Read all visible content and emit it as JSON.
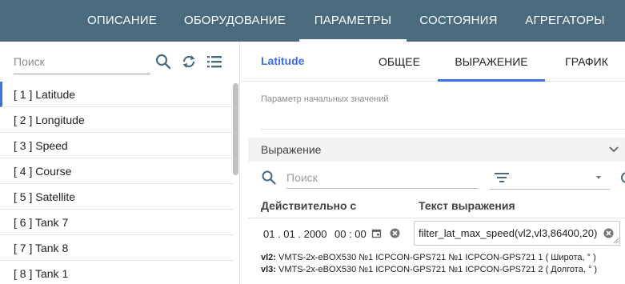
{
  "topnav": {
    "tabs": [
      {
        "label": "ОПИСАНИЕ"
      },
      {
        "label": "ОБОРУДОВАНИЕ"
      },
      {
        "label": "ПАРАМЕТРЫ"
      },
      {
        "label": "СОСТОЯНИЯ"
      },
      {
        "label": "АГРЕГАТОРЫ"
      }
    ],
    "active": "ПАРАМЕТРЫ"
  },
  "sidebar": {
    "search_placeholder": "Поиск",
    "icons": [
      "search-icon",
      "refresh-icon",
      "list-icon"
    ],
    "items": [
      {
        "label": "[ 1 ] Latitude",
        "selected": true
      },
      {
        "label": "[ 2 ] Longitude"
      },
      {
        "label": "[ 3 ] Speed"
      },
      {
        "label": "[ 4 ] Course"
      },
      {
        "label": "[ 5 ] Satellite"
      },
      {
        "label": "[ 6 ] Tank 7"
      },
      {
        "label": "[ 7 ] Tank 8"
      },
      {
        "label": "[ 8 ] Tank 1"
      }
    ]
  },
  "content": {
    "param_title": "Latitude",
    "tabs": [
      {
        "label": "ОБЩЕЕ"
      },
      {
        "label": "ВЫРАЖЕНИЕ"
      },
      {
        "label": "ГРАФИК"
      }
    ],
    "active_tab": "ВЫРАЖЕНИЕ",
    "initial_values_label": "Параметр начальных значений"
  },
  "expression": {
    "title": "Выражение",
    "search_placeholder": "Поиск",
    "columns": {
      "valid_from": "Действительно с",
      "expr_text": "Текст выражения"
    },
    "row": {
      "date": "01 . 01 . 2000",
      "time": "00 : 00",
      "expression": "filter_lat_max_speed(vl2,vl3,86400,20)"
    },
    "vars": [
      {
        "name": "vl2:",
        "text": " VMTS-2x-eBOX530 №1 ICPCON-GPS721 №1 ICPCON-GPS721 1 ( Широта, ° )"
      },
      {
        "name": "vl3:",
        "text": " VMTS-2x-eBOX530 №1 ICPCON-GPS721 №1 ICPCON-GPS721 2 ( Долгота, ° )"
      }
    ]
  },
  "colors": {
    "topnav_bg": "#4a6b7d",
    "accent": "#3f6fe0",
    "panel_header_bg": "#f2f2f2"
  }
}
